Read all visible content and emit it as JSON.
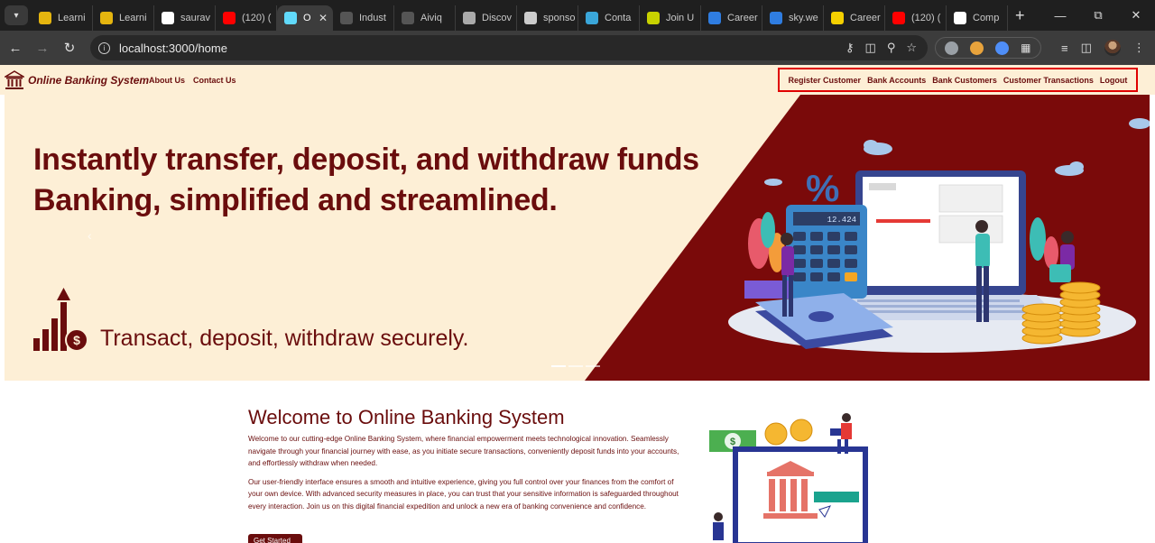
{
  "browser": {
    "tabs": [
      {
        "title": "Learni",
        "favicon": "#e5b50f"
      },
      {
        "title": "Learni",
        "favicon": "#e5b50f"
      },
      {
        "title": "saurav",
        "favicon": "#ffffff"
      },
      {
        "title": "(120) (",
        "favicon": "#ff0000"
      },
      {
        "title": "O",
        "favicon": "#61dafb",
        "active": true
      },
      {
        "title": "Indust",
        "favicon": "#555555"
      },
      {
        "title": "Aiviq",
        "favicon": "#555555"
      },
      {
        "title": "Discov",
        "favicon": "#aaaaaa"
      },
      {
        "title": "sponso",
        "favicon": "#cccccc"
      },
      {
        "title": "Conta",
        "favicon": "#3aa6d9"
      },
      {
        "title": "Join U",
        "favicon": "#c8d200"
      },
      {
        "title": "Career",
        "favicon": "#2f7de1"
      },
      {
        "title": "sky.we",
        "favicon": "#2f7de1"
      },
      {
        "title": "Career",
        "favicon": "#f5d000"
      },
      {
        "title": "(120) (",
        "favicon": "#ff0000"
      },
      {
        "title": "Comp",
        "favicon": "#ffffff"
      }
    ],
    "url": "localhost:3000/home"
  },
  "navbar": {
    "brand": "Online Banking System",
    "left_links": [
      "About Us",
      "Contact Us"
    ],
    "right_links": [
      "Register Customer",
      "Bank Accounts",
      "Bank Customers",
      "Customer Transactions",
      "Logout"
    ]
  },
  "hero": {
    "line1": "Instantly transfer, deposit, and withdraw funds",
    "line2": "Banking, simplified and streamlined.",
    "tagline": "Transact, deposit, withdraw securely.",
    "calc_display": "12.424",
    "colors": {
      "cream": "#fdefd6",
      "maroon": "#7a0a0a"
    }
  },
  "welcome": {
    "title": "Welcome to Online Banking System",
    "p1": "Welcome to our cutting-edge Online Banking System, where financial empowerment meets technological innovation. Seamlessly navigate through your financial journey with ease, as you initiate secure transactions, conveniently deposit funds into your accounts, and effortlessly withdraw when needed.",
    "p2": "Our user-friendly interface ensures a smooth and intuitive experience, giving you full control over your finances from the comfort of your own device. With advanced security measures in place, you can trust that your sensitive information is safeguarded throughout every interaction. Join us on this digital financial expedition and unlock a new era of banking convenience and confidence.",
    "button": "Get Started"
  }
}
